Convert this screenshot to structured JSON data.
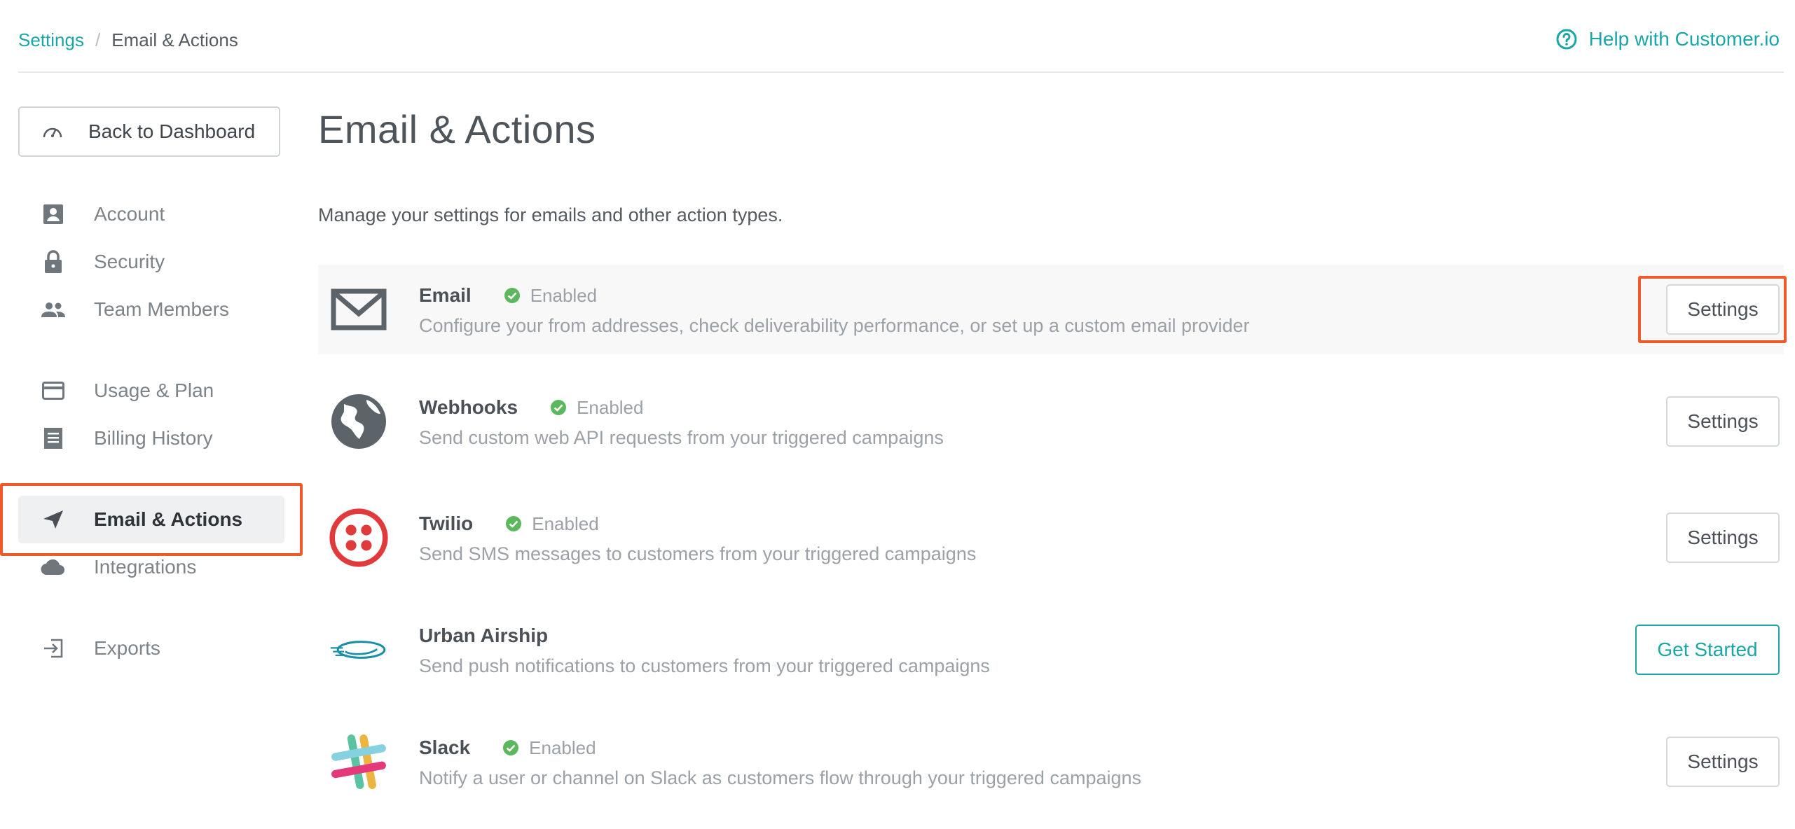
{
  "breadcrumb": {
    "parent": "Settings",
    "separator": "/",
    "current": "Email & Actions"
  },
  "help": {
    "label": "Help with Customer.io",
    "icon": "question-circle-icon"
  },
  "sidebar": {
    "back_label": "Back to Dashboard",
    "items": [
      {
        "label": "Account",
        "icon": "account-icon"
      },
      {
        "label": "Security",
        "icon": "lock-icon"
      },
      {
        "label": "Team Members",
        "icon": "people-icon"
      },
      {
        "label": "Usage & Plan",
        "icon": "credit-card-icon"
      },
      {
        "label": "Billing History",
        "icon": "receipt-icon"
      },
      {
        "label": "Email & Actions",
        "icon": "paper-plane-icon",
        "active": true
      },
      {
        "label": "Integrations",
        "icon": "cloud-icon"
      },
      {
        "label": "Exports",
        "icon": "export-icon"
      }
    ]
  },
  "main": {
    "title": "Email & Actions",
    "subtitle": "Manage your settings for emails and other action types.",
    "actions": [
      {
        "name": "Email",
        "status": "Enabled",
        "description": "Configure your from addresses, check deliverability performance, or set up a custom email provider",
        "button": "Settings",
        "icon": "envelope-icon"
      },
      {
        "name": "Webhooks",
        "status": "Enabled",
        "description": "Send custom web API requests from your triggered campaigns",
        "button": "Settings",
        "icon": "globe-icon"
      },
      {
        "name": "Twilio",
        "status": "Enabled",
        "description": "Send SMS messages to customers from your triggered campaigns",
        "button": "Settings",
        "icon": "twilio-logo-icon"
      },
      {
        "name": "Urban Airship",
        "description": "Send push notifications to customers from your triggered campaigns",
        "button": "Get Started",
        "icon": "airship-logo-icon"
      },
      {
        "name": "Slack",
        "status": "Enabled",
        "description": "Notify a user or channel on Slack as customers flow through your triggered campaigns",
        "button": "Settings",
        "icon": "slack-logo-icon"
      }
    ]
  },
  "colors": {
    "accent": "#1aa6a6",
    "highlight": "#f05a28",
    "enabled": "#5cb85c",
    "twilio": "#e03a3a"
  }
}
